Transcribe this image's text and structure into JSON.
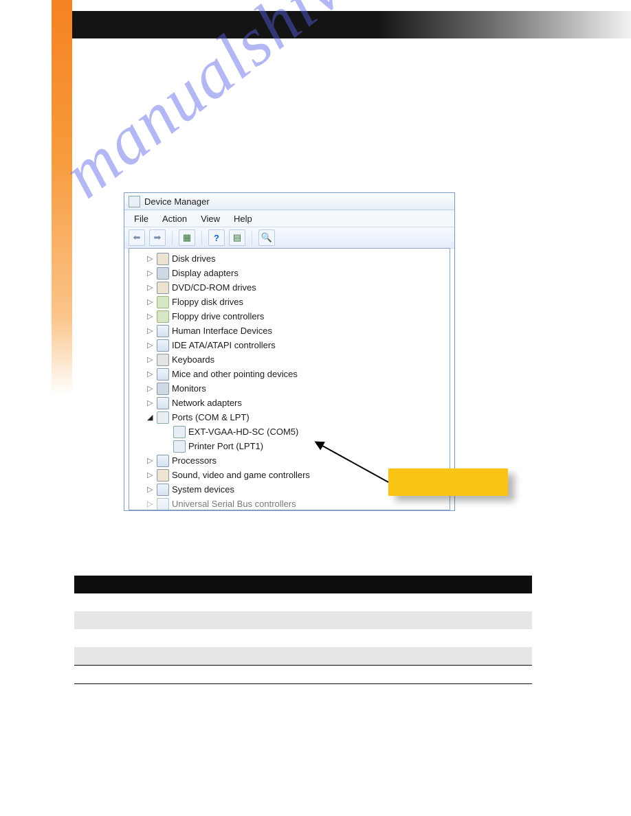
{
  "watermark": "manualshive.com",
  "window": {
    "title": "Device Manager",
    "menus": {
      "file": "File",
      "action": "Action",
      "view": "View",
      "help": "Help"
    }
  },
  "tree": {
    "items": [
      {
        "label": "Disk drives",
        "expanded": false,
        "level": 1
      },
      {
        "label": "Display adapters",
        "expanded": false,
        "level": 1
      },
      {
        "label": "DVD/CD-ROM drives",
        "expanded": false,
        "level": 1
      },
      {
        "label": "Floppy disk drives",
        "expanded": false,
        "level": 1
      },
      {
        "label": "Floppy drive controllers",
        "expanded": false,
        "level": 1
      },
      {
        "label": "Human Interface Devices",
        "expanded": false,
        "level": 1
      },
      {
        "label": "IDE ATA/ATAPI controllers",
        "expanded": false,
        "level": 1
      },
      {
        "label": "Keyboards",
        "expanded": false,
        "level": 1
      },
      {
        "label": "Mice and other pointing devices",
        "expanded": false,
        "level": 1
      },
      {
        "label": "Monitors",
        "expanded": false,
        "level": 1
      },
      {
        "label": "Network adapters",
        "expanded": false,
        "level": 1
      },
      {
        "label": "Ports (COM & LPT)",
        "expanded": true,
        "level": 1
      },
      {
        "label": "EXT-VGAA-HD-SC (COM5)",
        "expanded": false,
        "level": 2,
        "leaf": true
      },
      {
        "label": "Printer Port (LPT1)",
        "expanded": false,
        "level": 2,
        "leaf": true
      },
      {
        "label": "Processors",
        "expanded": false,
        "level": 1
      },
      {
        "label": "Sound, video and game controllers",
        "expanded": false,
        "level": 1
      },
      {
        "label": "System devices",
        "expanded": false,
        "level": 1
      },
      {
        "label": "Universal Serial Bus controllers",
        "expanded": false,
        "level": 1
      }
    ]
  },
  "table": {
    "header": {
      "c1": "",
      "c2": ""
    },
    "rows": [
      {
        "c1": "",
        "c2": ""
      },
      {
        "c1": "",
        "c2": ""
      },
      {
        "c1": "",
        "c2": ""
      },
      {
        "c1": "",
        "c2": ""
      }
    ]
  }
}
